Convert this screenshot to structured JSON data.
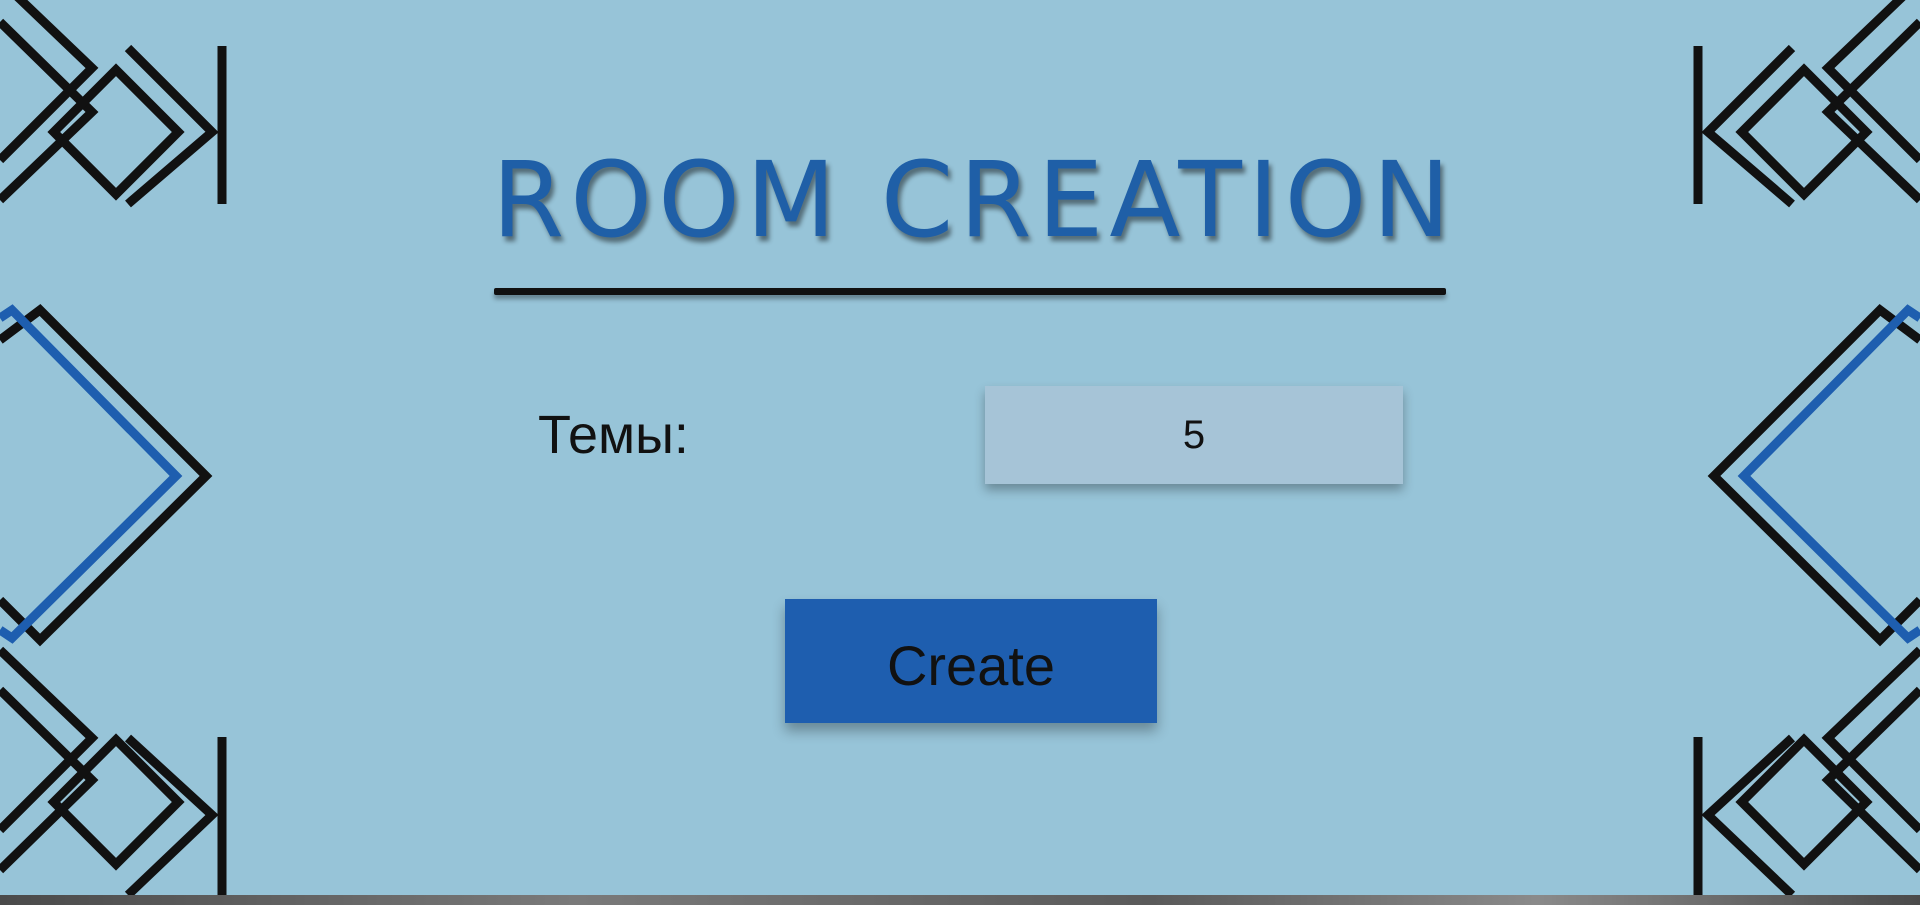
{
  "page": {
    "title": "ROOM CREATION"
  },
  "form": {
    "topics_label": "Темы:",
    "topics_value": "5",
    "create_label": "Create"
  },
  "colors": {
    "background": "#97c4d8",
    "accent": "#1e5eaf",
    "title": "#1f5fa7",
    "ornament_dark": "#111111",
    "ornament_blue": "#1e5eaf"
  },
  "icons": {
    "left_ornament": "geometric-ornament-icon",
    "right_ornament": "geometric-ornament-icon"
  }
}
